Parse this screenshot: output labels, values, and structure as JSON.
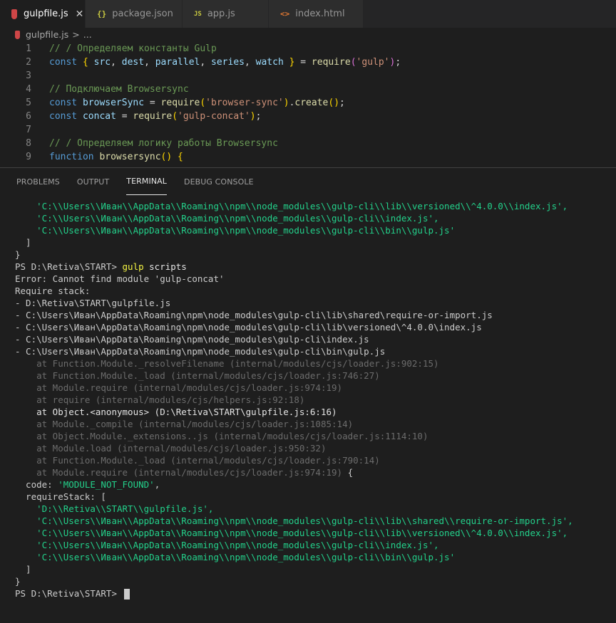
{
  "tabs": [
    {
      "label": "gulpfile.js",
      "icon": "gulp-file-icon",
      "active": true
    },
    {
      "label": "package.json",
      "icon": "json-file-icon",
      "active": false
    },
    {
      "label": "app.js",
      "icon": "js-file-icon",
      "active": false
    },
    {
      "label": "index.html",
      "icon": "html-file-icon",
      "active": false
    }
  ],
  "tab_close_glyph": "✕",
  "breadcrumb": {
    "file": "gulpfile.js",
    "separator": ">",
    "rest": "..."
  },
  "editor": {
    "line_numbers": [
      "1",
      "2",
      "3",
      "4",
      "5",
      "6",
      "7",
      "8",
      "9"
    ]
  },
  "panel_tabs": [
    "PROBLEMS",
    "OUTPUT",
    "TERMINAL",
    "DEBUG CONSOLE"
  ],
  "panel_active_tab": "TERMINAL",
  "terminal": {
    "top_paths": [
      "    'C:\\\\Users\\\\Иван\\\\AppData\\\\Roaming\\\\npm\\\\node_modules\\\\gulp-cli\\\\lib\\\\versioned\\\\^4.0.0\\\\index.js',",
      "    'C:\\\\Users\\\\Иван\\\\AppData\\\\Roaming\\\\npm\\\\node_modules\\\\gulp-cli\\\\index.js',",
      "    'C:\\\\Users\\\\Иван\\\\AppData\\\\Roaming\\\\npm\\\\node_modules\\\\gulp-cli\\\\bin\\\\gulp.js'"
    ],
    "close_bracket": "  ]",
    "close_brace": "}",
    "prompt": "PS D:\\Retiva\\START> ",
    "command": "gulp",
    "command_arg": " scripts",
    "error_line": "Error: Cannot find module 'gulp-concat'",
    "require_stack_label": "Require stack:",
    "require_stack": [
      "- D:\\Retiva\\START\\gulpfile.js",
      "- C:\\Users\\Иван\\AppData\\Roaming\\npm\\node_modules\\gulp-cli\\lib\\shared\\require-or-import.js",
      "- C:\\Users\\Иван\\AppData\\Roaming\\npm\\node_modules\\gulp-cli\\lib\\versioned\\^4.0.0\\index.js",
      "- C:\\Users\\Иван\\AppData\\Roaming\\npm\\node_modules\\gulp-cli\\index.js",
      "- C:\\Users\\Иван\\AppData\\Roaming\\npm\\node_modules\\gulp-cli\\bin\\gulp.js"
    ],
    "stack_trace": [
      {
        "text": "    at Function.Module._resolveFilename (internal/modules/cjs/loader.js:902:15)",
        "dim": true
      },
      {
        "text": "    at Function.Module._load (internal/modules/cjs/loader.js:746:27)",
        "dim": true
      },
      {
        "text": "    at Module.require (internal/modules/cjs/loader.js:974:19)",
        "dim": true
      },
      {
        "text": "    at require (internal/modules/cjs/helpers.js:92:18)",
        "dim": true
      },
      {
        "text": "    at Object.<anonymous> (D:\\Retiva\\START\\gulpfile.js:6:16)",
        "dim": false
      },
      {
        "text": "    at Module._compile (internal/modules/cjs/loader.js:1085:14)",
        "dim": true
      },
      {
        "text": "    at Object.Module._extensions..js (internal/modules/cjs/loader.js:1114:10)",
        "dim": true
      },
      {
        "text": "    at Module.load (internal/modules/cjs/loader.js:950:32)",
        "dim": true
      },
      {
        "text": "    at Function.Module._load (internal/modules/cjs/loader.js:790:14)",
        "dim": true
      },
      {
        "text": "    at Module.require (internal/modules/cjs/loader.js:974:19)",
        "dim": true
      }
    ],
    "stack_trailing_brace": " {",
    "code_key": "  code: ",
    "code_value": "'MODULE_NOT_FOUND'",
    "code_comma": ",",
    "require_stack_key": "  requireStack: [",
    "bottom_paths": [
      "    'D:\\\\Retiva\\\\START\\\\gulpfile.js',",
      "    'C:\\\\Users\\\\Иван\\\\AppData\\\\Roaming\\\\npm\\\\node_modules\\\\gulp-cli\\\\lib\\\\shared\\\\require-or-import.js',",
      "    'C:\\\\Users\\\\Иван\\\\AppData\\\\Roaming\\\\npm\\\\node_modules\\\\gulp-cli\\\\lib\\\\versioned\\\\^4.0.0\\\\index.js',",
      "    'C:\\\\Users\\\\Иван\\\\AppData\\\\Roaming\\\\npm\\\\node_modules\\\\gulp-cli\\\\index.js',",
      "    'C:\\\\Users\\\\Иван\\\\AppData\\\\Roaming\\\\npm\\\\node_modules\\\\gulp-cli\\\\bin\\\\gulp.js'"
    ],
    "final_prompt": "PS D:\\Retiva\\START> "
  },
  "colors": {
    "background": "#1e1e1e",
    "terminal_path_green": "#23d18b",
    "command_yellow": "#f5f543",
    "comment_green": "#6a9955",
    "keyword_blue": "#569cd6",
    "string_orange": "#ce9178"
  }
}
